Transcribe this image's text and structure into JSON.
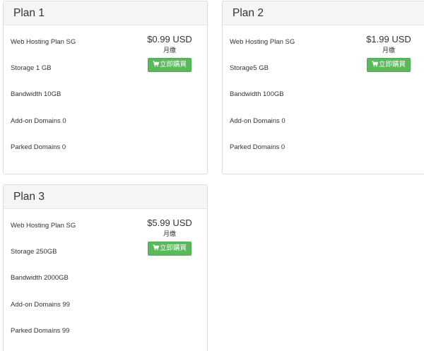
{
  "plans": [
    {
      "title": "Plan 1",
      "features": [
        "Web Hosting Plan SG",
        "Storage 1 GB",
        "Bandwidth 10GB",
        "Add-on Domains 0",
        "Parked Domains 0"
      ],
      "price": "$0.99 USD",
      "cycle": "月缴",
      "buy_label": "立即購買",
      "button_icon": "shopping-cart-icon"
    },
    {
      "title": "Plan 2",
      "features": [
        "Web Hosting Plan SG",
        "Storage5 GB",
        "Bandwidth 100GB",
        "Add-on Domains 0",
        "Parked Domains 0"
      ],
      "price": "$1.99 USD",
      "cycle": "月缴",
      "buy_label": "立即購買",
      "button_icon": "shopping-cart-icon"
    },
    {
      "title": "Plan 3",
      "features": [
        "Web Hosting Plan SG",
        "Storage 250GB",
        "Bandwidth 2000GB",
        "Add-on Domains 99",
        "Parked Domains 99"
      ],
      "price": "$5.99 USD",
      "cycle": "月缴",
      "buy_label": "立即購買",
      "button_icon": "shopping-cart-icon"
    }
  ],
  "colors": {
    "button": "#5cb85c",
    "header_bg": "#f5f5f5",
    "border": "#dddddd"
  }
}
